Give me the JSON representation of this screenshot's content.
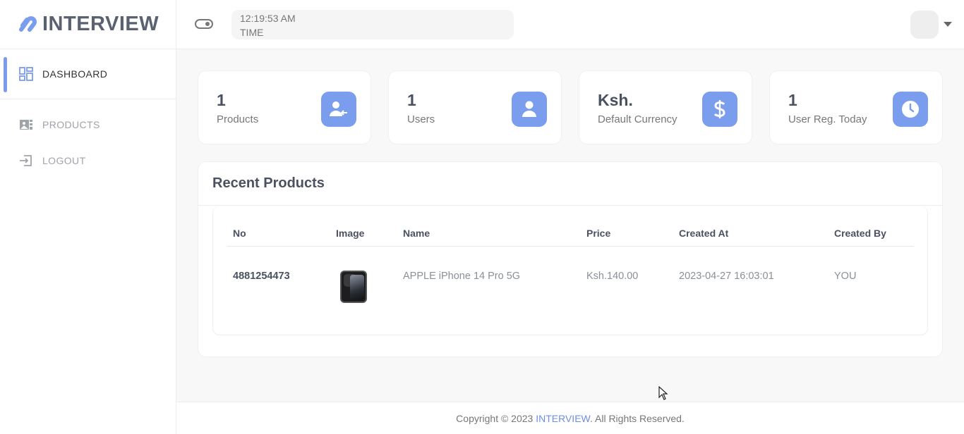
{
  "brand": {
    "name": "INTERVIEW",
    "logo_icon": "link-logo-icon",
    "accent": "#7b9ded"
  },
  "sidebar": {
    "items": [
      {
        "label": "DASHBOARD",
        "icon": "dashboard-grid-icon",
        "active": true
      },
      {
        "label": "PRODUCTS",
        "icon": "products-image-icon",
        "active": false
      },
      {
        "label": "LOGOUT",
        "icon": "logout-icon",
        "active": false
      }
    ]
  },
  "topbar": {
    "toggle_icon": "toggle-switch-icon",
    "time_value": "12:19:53 AM",
    "time_label": "TIME",
    "avatar_icon": "avatar",
    "caret_icon": "chevron-down-icon"
  },
  "stats": [
    {
      "value": "1",
      "label": "Products",
      "icon": "user-arrow-icon"
    },
    {
      "value": "1",
      "label": "Users",
      "icon": "user-icon"
    },
    {
      "value": "Ksh.",
      "label": "Default Currency",
      "icon": "dollar-icon"
    },
    {
      "value": "1",
      "label": "User Reg. Today",
      "icon": "clock-icon"
    }
  ],
  "recent_products": {
    "title": "Recent Products",
    "columns": [
      "No",
      "Image",
      "Name",
      "Price",
      "Created At",
      "Created By"
    ],
    "rows": [
      {
        "no": "4881254473",
        "image": "iphone-image",
        "name": "APPLE iPhone 14 Pro 5G",
        "price": "Ksh.140.00",
        "created_at": "2023-04-27 16:03:01",
        "created_by": "YOU"
      }
    ]
  },
  "footer": {
    "prefix": "Copyright © 2023 ",
    "brand": "INTERVIEW",
    "suffix": ". All Rights Reserved."
  }
}
